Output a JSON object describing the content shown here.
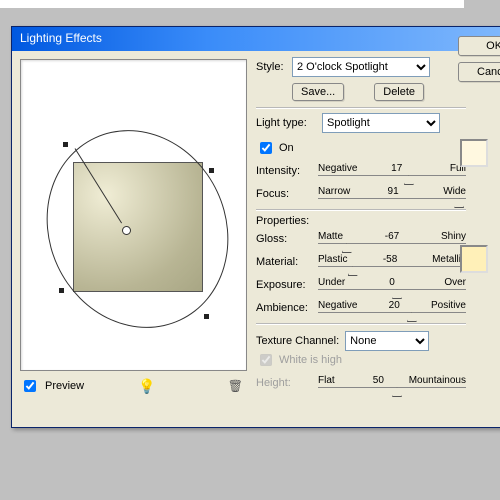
{
  "window": {
    "title": "Lighting Effects"
  },
  "buttons": {
    "ok": "OK",
    "cancel": "Cancel",
    "save": "Save...",
    "delete": "Delete"
  },
  "style": {
    "label": "Style:",
    "value": "2 O'clock Spotlight"
  },
  "light_type": {
    "label": "Light type:",
    "value": "Spotlight"
  },
  "on": {
    "label": "On",
    "checked": true
  },
  "sliders": {
    "intensity": {
      "label": "Intensity:",
      "left": "Negative",
      "value": "17",
      "right": "Full",
      "pos": 58
    },
    "focus": {
      "label": "Focus:",
      "left": "Narrow",
      "value": "91",
      "right": "Wide",
      "pos": 92
    },
    "gloss": {
      "label": "Gloss:",
      "left": "Matte",
      "value": "-67",
      "right": "Shiny",
      "pos": 16
    },
    "material": {
      "label": "Material:",
      "left": "Plastic",
      "value": "-58",
      "right": "Metallic",
      "pos": 20
    },
    "exposure": {
      "label": "Exposure:",
      "left": "Under",
      "value": "0",
      "right": "Over",
      "pos": 50
    },
    "ambience": {
      "label": "Ambience:",
      "left": "Negative",
      "value": "20",
      "right": "Positive",
      "pos": 60
    },
    "height": {
      "label": "Height:",
      "left": "Flat",
      "value": "50",
      "right": "Mountainous",
      "pos": 50
    }
  },
  "properties": {
    "label": "Properties:"
  },
  "texture": {
    "label": "Texture Channel:",
    "value": "None",
    "white": "White is high"
  },
  "preview": {
    "label": "Preview"
  },
  "swatch": {
    "light": "#fff7e0",
    "ambience": "#ffeeb8"
  }
}
